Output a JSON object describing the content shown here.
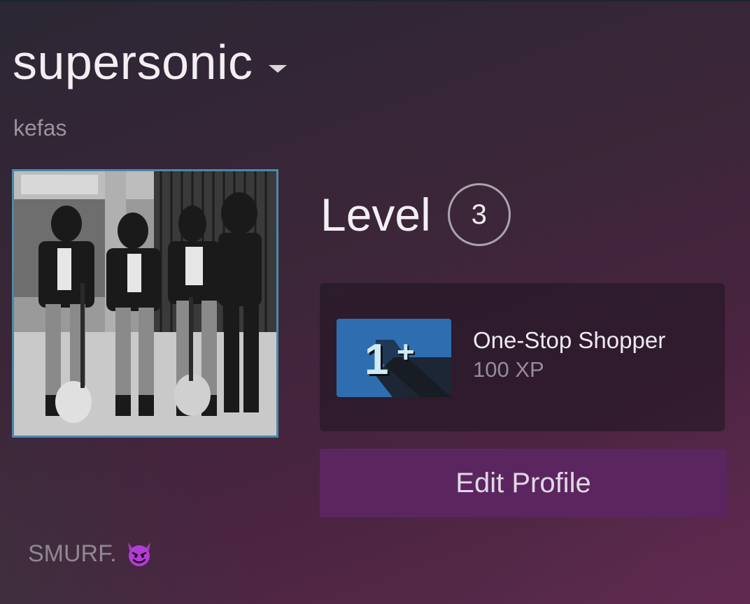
{
  "profile": {
    "username": "supersonic",
    "real_name": "kefas",
    "level_label": "Level",
    "level_value": "3",
    "summary": "SMURF.",
    "summary_emoji": "smiling-imp-emoji"
  },
  "badge": {
    "name": "One-Stop Shopper",
    "xp": "100 XP",
    "icon_text": "1+",
    "icon": "one-plus-badge-icon"
  },
  "actions": {
    "edit_profile": "Edit Profile"
  },
  "colors": {
    "avatar_border": "#4b8aa8",
    "edit_button": "#5b2660",
    "badge_blue": "#2e6db0"
  }
}
